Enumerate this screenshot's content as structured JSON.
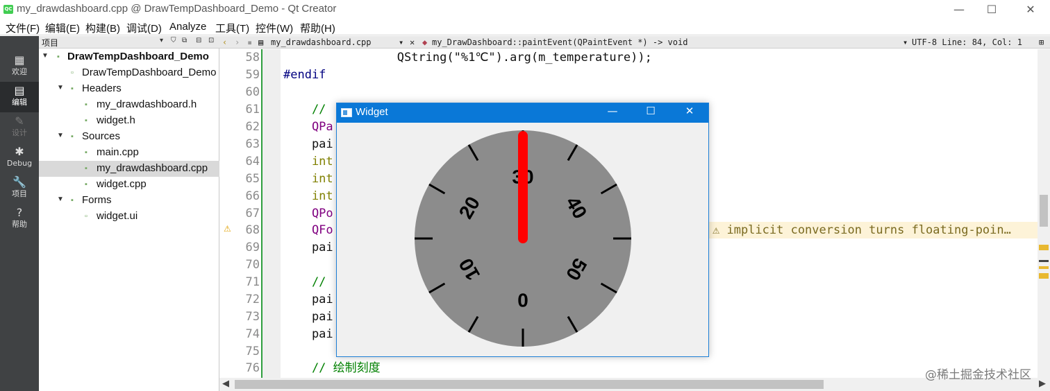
{
  "titlebar": {
    "icon_text": "QC",
    "title": "my_drawdashboard.cpp @ DrawTempDashboard_Demo - Qt Creator",
    "minimize": "—",
    "maximize": "☐",
    "close": "✕"
  },
  "menu": [
    "文件(F)",
    "编辑(E)",
    "构建(B)",
    "调试(D)",
    "Analyze",
    "工具(T)",
    "控件(W)",
    "帮助(H)"
  ],
  "modes": [
    {
      "icon": "▦",
      "label": "欢迎"
    },
    {
      "icon": "▤",
      "label": "编辑"
    },
    {
      "icon": "✎",
      "label": "设计"
    },
    {
      "icon": "✱",
      "label": "Debug"
    },
    {
      "icon": "🔧",
      "label": "项目"
    },
    {
      "icon": "?",
      "label": "帮助"
    }
  ],
  "project_panel": {
    "header": "项目",
    "tree": [
      {
        "name": "DrawTempDashboard_Demo",
        "arrow": "▼",
        "icon": "▪"
      },
      {
        "name": "DrawTempDashboard_Demo",
        "arrow": "",
        "icon": "▫"
      },
      {
        "name": "Headers",
        "arrow": "▼",
        "icon": "▪"
      },
      {
        "name": "my_drawdashboard.h",
        "arrow": "",
        "icon": "▪"
      },
      {
        "name": "widget.h",
        "arrow": "",
        "icon": "▪"
      },
      {
        "name": "Sources",
        "arrow": "▼",
        "icon": "▪"
      },
      {
        "name": "main.cpp",
        "arrow": "",
        "icon": "▪"
      },
      {
        "name": "my_drawdashboard.cpp",
        "arrow": "",
        "icon": "▪"
      },
      {
        "name": "widget.cpp",
        "arrow": "",
        "icon": "▪"
      },
      {
        "name": "Forms",
        "arrow": "▼",
        "icon": "▪"
      },
      {
        "name": "widget.ui",
        "arrow": "",
        "icon": "▫"
      }
    ]
  },
  "editor_toolbar": {
    "file": "my_drawdashboard.cpp",
    "function": "my_DrawDashboard::paintEvent(QPaintEvent *) -> void",
    "status": "UTF-8 Line: 84, Col: 1"
  },
  "editor": {
    "lines": [
      {
        "n": "58",
        "code": "                QString(\"%1℃\").arg(m_temperature));"
      },
      {
        "n": "59",
        "code": "#endif"
      },
      {
        "n": "60",
        "code": ""
      },
      {
        "n": "61",
        "code": "    // "
      },
      {
        "n": "62",
        "code": "    QPa"
      },
      {
        "n": "63",
        "code": "    pai"
      },
      {
        "n": "64",
        "code": "    int"
      },
      {
        "n": "65",
        "code": "    int"
      },
      {
        "n": "66",
        "code": "    int"
      },
      {
        "n": "67",
        "code": "    QPo"
      },
      {
        "n": "68",
        "code": "    QFo"
      },
      {
        "n": "69",
        "code": "    pai"
      },
      {
        "n": "70",
        "code": ""
      },
      {
        "n": "71",
        "code": "    // "
      },
      {
        "n": "72",
        "code": "    pai"
      },
      {
        "n": "73",
        "code": "    pai"
      },
      {
        "n": "74",
        "code": "    pai"
      },
      {
        "n": "75",
        "code": ""
      },
      {
        "n": "76",
        "code": "    // 绘制刻度"
      }
    ],
    "warning_mark": "⚠",
    "warning": "⚠ implicit conversion turns floating-poin…"
  },
  "widget": {
    "title": "Widget",
    "minimize": "—",
    "maximize": "☐",
    "close": "✕",
    "dial": {
      "labels": [
        "0",
        "10",
        "20",
        "30",
        "40",
        "50"
      ],
      "value": 30,
      "min": 0,
      "max": 60,
      "face_color": "#8c8c8c",
      "needle_color": "#ff0000"
    }
  },
  "watermark": "@稀土掘金技术社区"
}
